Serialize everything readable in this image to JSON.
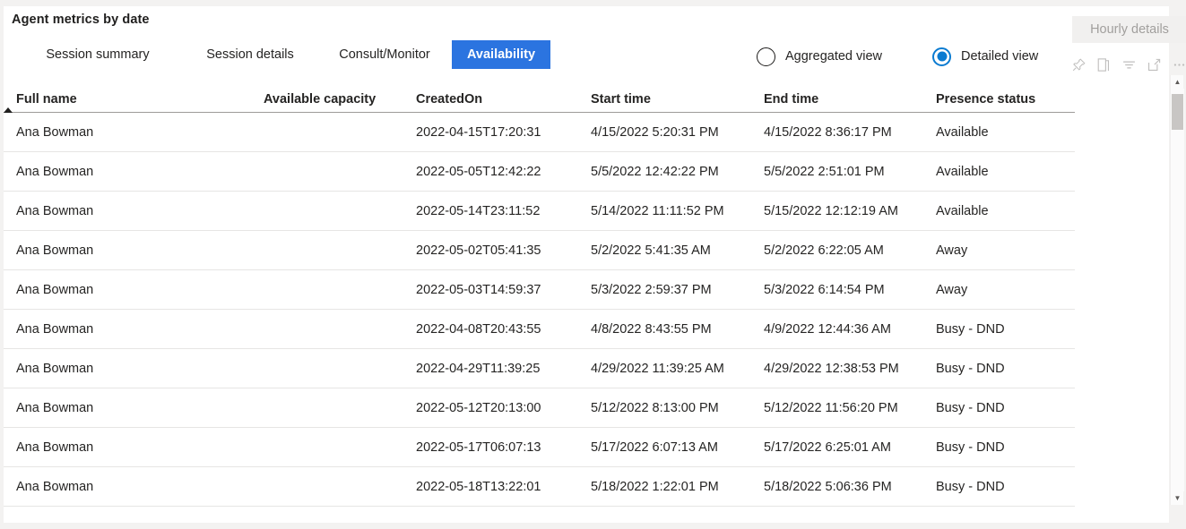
{
  "header": {
    "title": "Agent metrics by date",
    "hourly_details_label": "Hourly details",
    "tabs": [
      {
        "label": "Session summary",
        "active": false
      },
      {
        "label": "Session details",
        "active": false
      },
      {
        "label": "Consult/Monitor",
        "active": false
      },
      {
        "label": "Availability",
        "active": true
      }
    ],
    "view_radios": [
      {
        "label": "Aggregated view",
        "checked": false
      },
      {
        "label": "Detailed view",
        "checked": true
      }
    ],
    "visual_actions": [
      {
        "name": "pin-icon"
      },
      {
        "name": "copy-icon"
      },
      {
        "name": "filter-icon"
      },
      {
        "name": "focus-mode-icon"
      },
      {
        "name": "more-options-icon"
      }
    ]
  },
  "colors": {
    "accent_tab": "#2b74e0",
    "accent_radio": "#0a7bd1",
    "header_rule": "#9d9b99",
    "row_rule": "#e6e5e4",
    "disabled_text": "#a19f9d",
    "page_background": "#f3f2f1",
    "surface": "#ffffff"
  },
  "table": {
    "sort_column_index": 0,
    "sort_direction": "ascending",
    "columns": [
      "Full name",
      "Available capacity",
      "CreatedOn",
      "Start time",
      "End time",
      "Presence status"
    ],
    "rows": [
      {
        "full_name": "Ana Bowman",
        "available_capacity": "",
        "created_on": "2022-04-15T17:20:31",
        "start_time": "4/15/2022 5:20:31 PM",
        "end_time": "4/15/2022 8:36:17 PM",
        "presence_status": "Available"
      },
      {
        "full_name": "Ana Bowman",
        "available_capacity": "",
        "created_on": "2022-05-05T12:42:22",
        "start_time": "5/5/2022 12:42:22 PM",
        "end_time": "5/5/2022 2:51:01 PM",
        "presence_status": "Available"
      },
      {
        "full_name": "Ana Bowman",
        "available_capacity": "",
        "created_on": "2022-05-14T23:11:52",
        "start_time": "5/14/2022 11:11:52 PM",
        "end_time": "5/15/2022 12:12:19 AM",
        "presence_status": "Available"
      },
      {
        "full_name": "Ana Bowman",
        "available_capacity": "",
        "created_on": "2022-05-02T05:41:35",
        "start_time": "5/2/2022 5:41:35 AM",
        "end_time": "5/2/2022 6:22:05 AM",
        "presence_status": "Away"
      },
      {
        "full_name": "Ana Bowman",
        "available_capacity": "",
        "created_on": "2022-05-03T14:59:37",
        "start_time": "5/3/2022 2:59:37 PM",
        "end_time": "5/3/2022 6:14:54 PM",
        "presence_status": "Away"
      },
      {
        "full_name": "Ana Bowman",
        "available_capacity": "",
        "created_on": "2022-04-08T20:43:55",
        "start_time": "4/8/2022 8:43:55 PM",
        "end_time": "4/9/2022 12:44:36 AM",
        "presence_status": "Busy - DND"
      },
      {
        "full_name": "Ana Bowman",
        "available_capacity": "",
        "created_on": "2022-04-29T11:39:25",
        "start_time": "4/29/2022 11:39:25 AM",
        "end_time": "4/29/2022 12:38:53 PM",
        "presence_status": "Busy - DND"
      },
      {
        "full_name": "Ana Bowman",
        "available_capacity": "",
        "created_on": "2022-05-12T20:13:00",
        "start_time": "5/12/2022 8:13:00 PM",
        "end_time": "5/12/2022 11:56:20 PM",
        "presence_status": "Busy - DND"
      },
      {
        "full_name": "Ana Bowman",
        "available_capacity": "",
        "created_on": "2022-05-17T06:07:13",
        "start_time": "5/17/2022 6:07:13 AM",
        "end_time": "5/17/2022 6:25:01 AM",
        "presence_status": "Busy - DND"
      },
      {
        "full_name": "Ana Bowman",
        "available_capacity": "",
        "created_on": "2022-05-18T13:22:01",
        "start_time": "5/18/2022 1:22:01 PM",
        "end_time": "5/18/2022 5:06:36 PM",
        "presence_status": "Busy - DND"
      }
    ]
  },
  "scrollbar": {
    "up_arrow": "▲",
    "down_arrow": "▼"
  }
}
